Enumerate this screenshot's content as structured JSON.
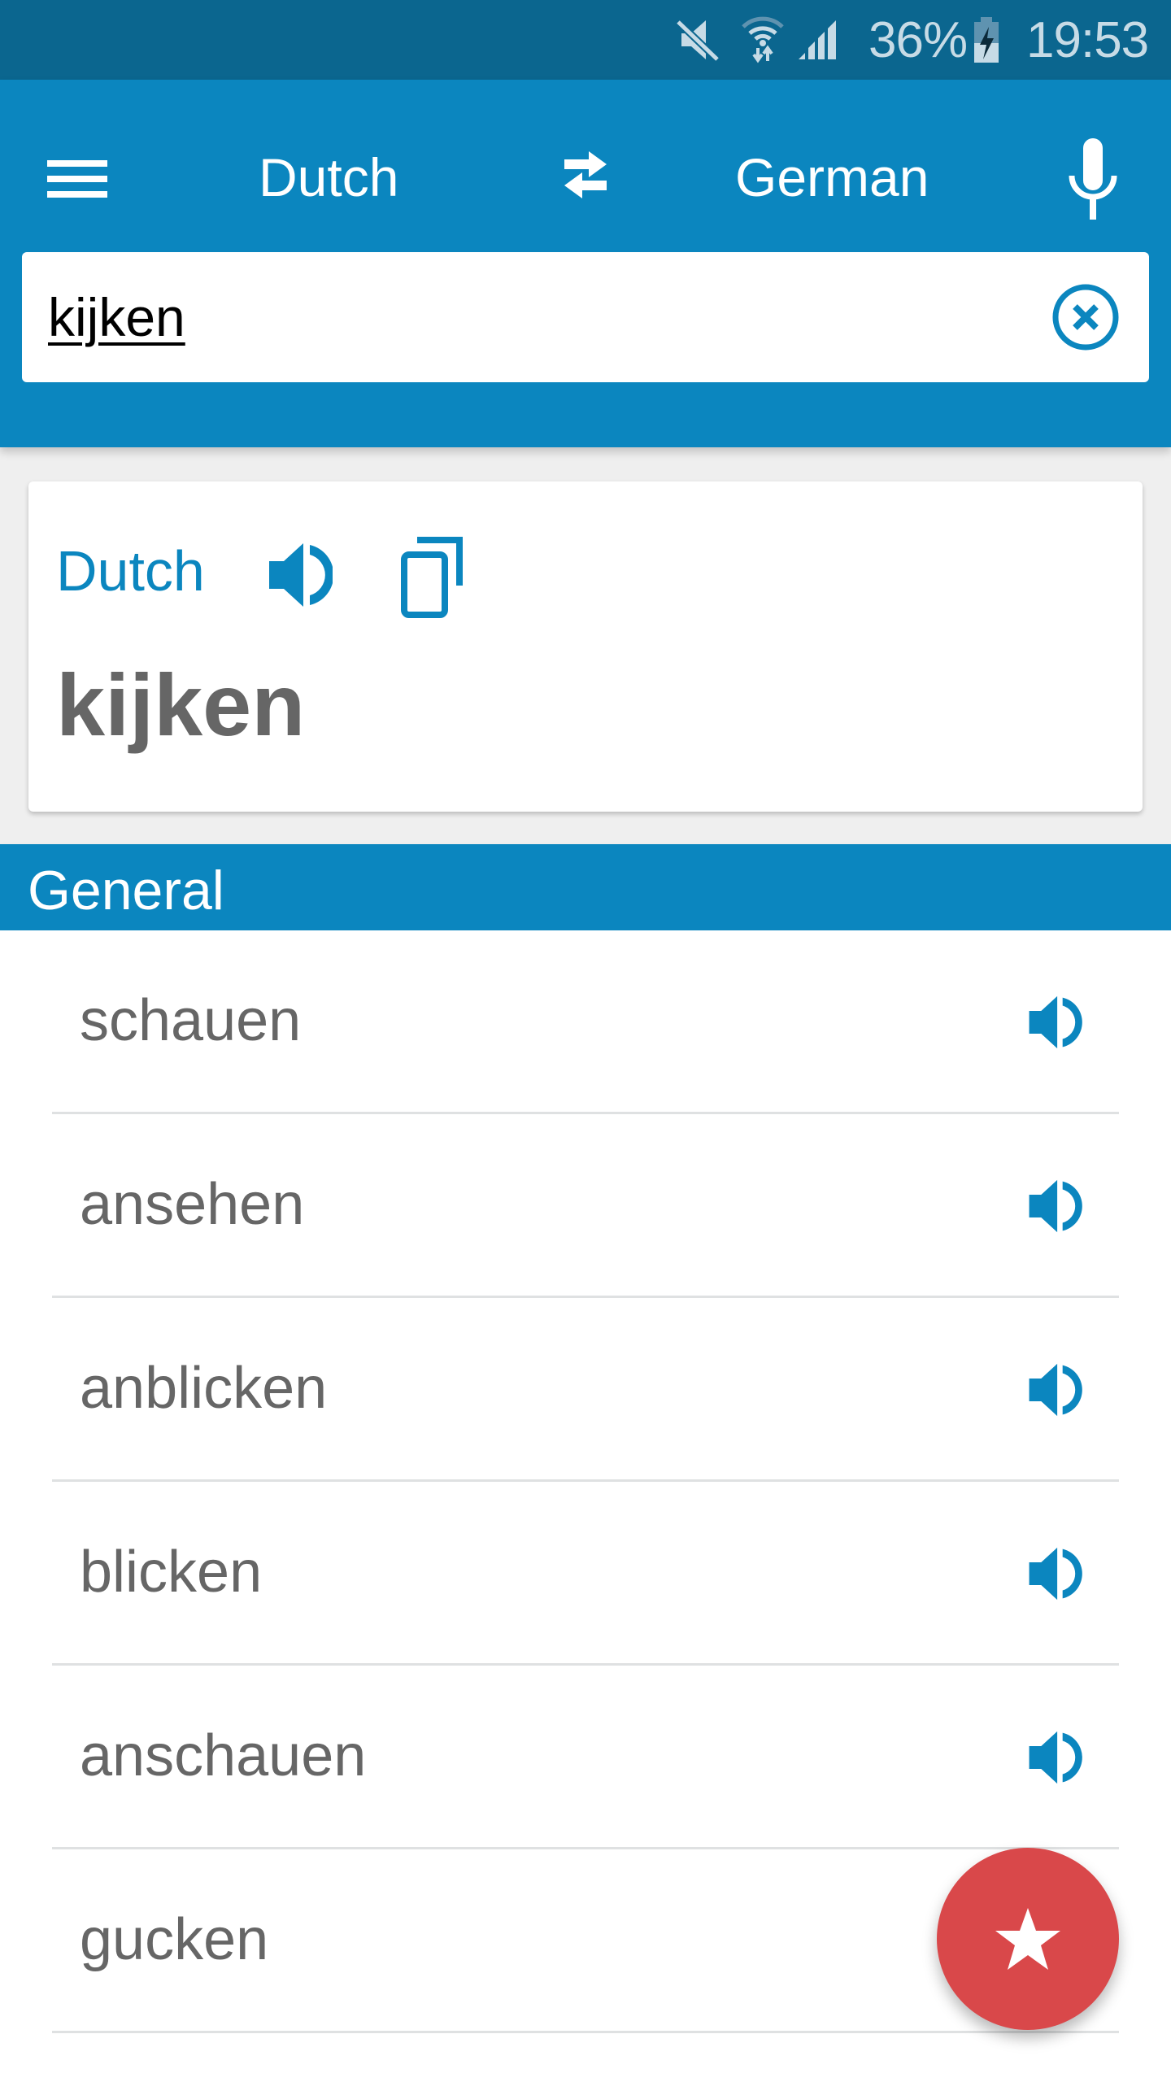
{
  "status_bar": {
    "icons": [
      "mute-icon",
      "wifi-icon",
      "signal-icon",
      "battery-charging-icon"
    ],
    "battery_percent": "36%",
    "time": "19:53"
  },
  "toolbar": {
    "menu_icon": "hamburger-menu-icon",
    "source_language": "Dutch",
    "swap_icon": "swap-arrows-icon",
    "target_language": "German",
    "mic_icon": "microphone-icon"
  },
  "search": {
    "value": "kijken",
    "placeholder": "",
    "clear_icon": "clear-circle-icon"
  },
  "source_card": {
    "language": "Dutch",
    "speaker_icon": "speaker-icon",
    "copy_icon": "copy-icon",
    "word": "kijken"
  },
  "section": {
    "title": "General"
  },
  "translations": [
    {
      "word": "schauen",
      "icon": "speaker-icon"
    },
    {
      "word": "ansehen",
      "icon": "speaker-icon"
    },
    {
      "word": "anblicken",
      "icon": "speaker-icon"
    },
    {
      "word": "blicken",
      "icon": "speaker-icon"
    },
    {
      "word": "anschauen",
      "icon": "speaker-icon"
    },
    {
      "word": "gucken",
      "icon": null
    }
  ],
  "fab": {
    "icon": "star-icon"
  },
  "colors": {
    "status_bar": "#0b668f",
    "primary": "#0b86bf",
    "fab": "#d9484a",
    "text_gray": "#666666",
    "separator": "#dfe1e2"
  }
}
